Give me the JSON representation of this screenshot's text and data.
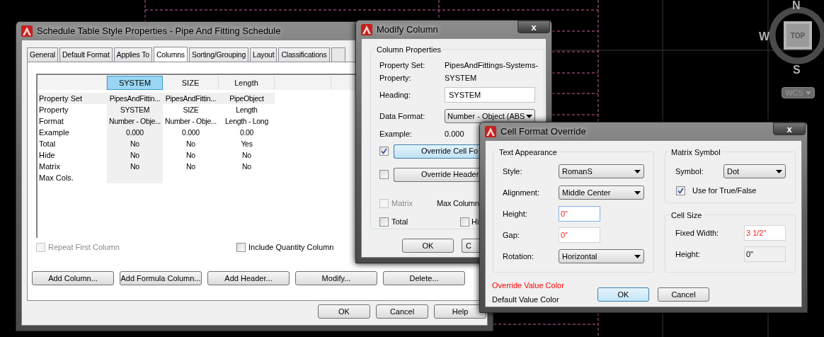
{
  "view_cube": {
    "north": "N",
    "west": "W",
    "south": "S",
    "face": "TOP",
    "ucs": "WCS"
  },
  "style_dialog": {
    "title": "Schedule Table Style Properties - Pipe And Fitting Schedule",
    "tabs": [
      {
        "label": "General",
        "selected": false
      },
      {
        "label": "Default Format",
        "selected": false
      },
      {
        "label": "Applies To",
        "selected": false
      },
      {
        "label": "Columns",
        "selected": true
      },
      {
        "label": "Sorting/Grouping",
        "selected": false
      },
      {
        "label": "Layout",
        "selected": false
      },
      {
        "label": "Classifications",
        "selected": false
      }
    ],
    "table": {
      "columns": [
        {
          "heading": "SYSTEM",
          "selected": true
        },
        {
          "heading": "SIZE",
          "selected": false
        },
        {
          "heading": "Length",
          "selected": false
        }
      ],
      "rows": [
        {
          "label": "Property Set",
          "selected": true,
          "cells": [
            "PipesAndFittin...",
            "PipesAndFittin...",
            "PipeObject"
          ]
        },
        {
          "label": "Property",
          "selected": false,
          "cells": [
            "SYSTEM",
            "SIZE",
            "Length"
          ]
        },
        {
          "label": "Format",
          "selected": false,
          "cells": [
            "Number - Obje...",
            "Number - Obje...",
            "Length - Long"
          ]
        },
        {
          "label": "Example",
          "selected": false,
          "cells": [
            "0.000",
            "0.000",
            "0.00"
          ]
        },
        {
          "label": "Total",
          "selected": false,
          "cells": [
            "No",
            "No",
            "Yes"
          ]
        },
        {
          "label": "Hide",
          "selected": false,
          "cells": [
            "No",
            "No",
            "No"
          ]
        },
        {
          "label": "Matrix",
          "selected": false,
          "cells": [
            "No",
            "No",
            "No"
          ]
        },
        {
          "label": "Max Cols.",
          "selected": false,
          "cells": []
        }
      ]
    },
    "options": [
      {
        "label": "Repeat First Column",
        "checked": false,
        "disabled": true
      },
      {
        "label": "Include Quantity Column",
        "checked": false,
        "disabled": false
      }
    ],
    "actions": [
      "Add Column...",
      "Add Formula Column...",
      "Add Header...",
      "Modify...",
      "Delete..."
    ],
    "footer_buttons": [
      "OK",
      "Cancel",
      "Help"
    ]
  },
  "modify_dialog": {
    "title": "Modify Column",
    "close": "x",
    "group": "Column Properties",
    "property_set": {
      "label": "Property Set:",
      "value": "PipesAndFittings-Systems-"
    },
    "property": {
      "label": "Property:",
      "value": "SYSTEM"
    },
    "heading": {
      "label": "Heading:",
      "value": "SYSTEM"
    },
    "data_format": {
      "label": "Data Format:",
      "value": "Number - Object (ABS"
    },
    "example": {
      "label": "Example:",
      "value": "0.000"
    },
    "overrides": [
      {
        "label": "Override Cell Fo",
        "checked": true,
        "focused": true
      },
      {
        "label": "Override Header",
        "checked": false,
        "focused": false
      }
    ],
    "matrix": {
      "label": "Matrix",
      "checked": false,
      "disabled": true
    },
    "max_columns": "Max Column",
    "total": {
      "label": "Total",
      "checked": false
    },
    "hide": {
      "label": "Hi",
      "checked": false
    },
    "buttons": [
      "OK",
      "C"
    ]
  },
  "override_dialog": {
    "title": "Cell Format Override",
    "close": "x",
    "text_appearance": {
      "title": "Text Appearance",
      "rows": [
        {
          "kind": "select",
          "label": "Style:",
          "value": "RomanS"
        },
        {
          "kind": "select",
          "label": "Alignment:",
          "value": "Middle Center"
        },
        {
          "kind": "field",
          "label": "Height:",
          "value": "0\"",
          "overridden": true,
          "focused": true
        },
        {
          "kind": "field",
          "label": "Gap:",
          "value": "0\"",
          "overridden": true,
          "focused": false
        },
        {
          "kind": "select",
          "label": "Rotation:",
          "value": "Horizontal"
        }
      ]
    },
    "matrix_symbol": {
      "title": "Matrix Symbol",
      "symbol": {
        "label": "Symbol:",
        "value": "Dot"
      },
      "true_false": {
        "label": "Use for True/False",
        "checked": true
      }
    },
    "cell_size": {
      "title": "Cell Size",
      "rows": [
        {
          "kind": "field",
          "label": "Fixed Width:",
          "value": "3 1/2\"",
          "overridden": true,
          "disabled": false
        },
        {
          "kind": "field",
          "label": "Height:",
          "value": "0\"",
          "overridden": false,
          "disabled": true
        }
      ]
    },
    "legend": [
      {
        "label": "Override Value Color",
        "color": "#ff0000"
      },
      {
        "label": "Default Value Color",
        "color": "#000000"
      }
    ],
    "buttons": [
      {
        "label": "OK",
        "default": true
      },
      {
        "label": "Cancel",
        "default": false
      }
    ]
  }
}
